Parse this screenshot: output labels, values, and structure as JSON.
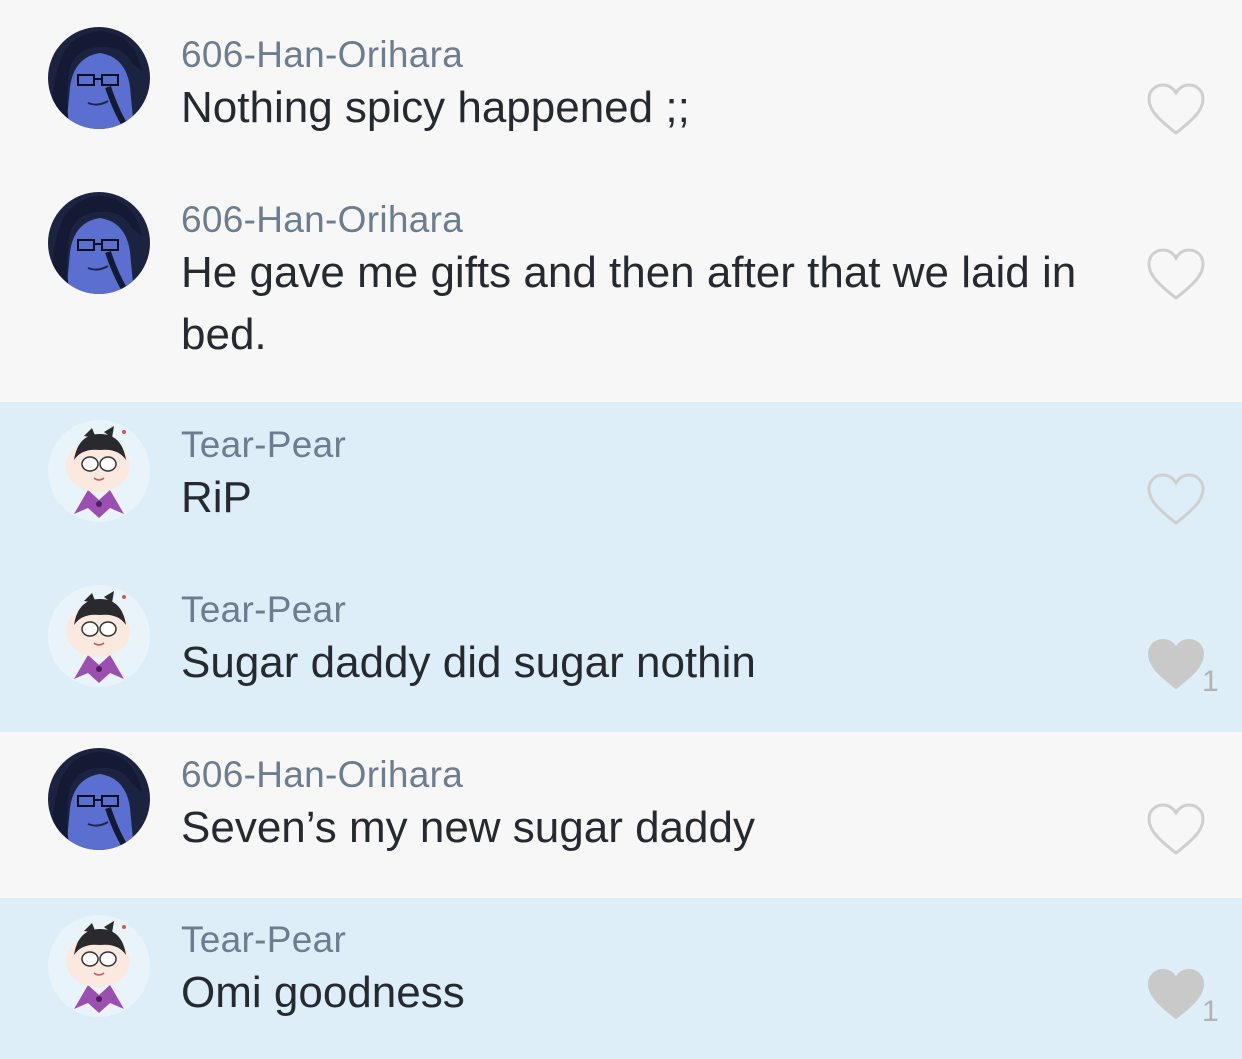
{
  "comments": [
    {
      "username": "606-Han-Orihara",
      "message": "Nothing spicy happened ;;",
      "avatar_icon": "dark-haired-character-avatar-icon",
      "liked": false,
      "likes": null
    },
    {
      "username": "606-Han-Orihara",
      "message": "He gave me gifts and then after that we laid in bed.",
      "avatar_icon": "dark-haired-character-avatar-icon",
      "liked": false,
      "likes": null
    },
    {
      "username": "Tear-Pear",
      "message": "RiP",
      "avatar_icon": "chibi-character-avatar-icon",
      "liked": false,
      "likes": null
    },
    {
      "username": "Tear-Pear",
      "message": "Sugar daddy did sugar nothin",
      "avatar_icon": "chibi-character-avatar-icon",
      "liked": true,
      "likes": "1"
    },
    {
      "username": "606-Han-Orihara",
      "message": "Seven’s my new sugar daddy",
      "avatar_icon": "dark-haired-character-avatar-icon",
      "liked": false,
      "likes": null
    },
    {
      "username": "Tear-Pear",
      "message": "Omi goodness",
      "avatar_icon": "chibi-character-avatar-icon",
      "liked": true,
      "likes": "1"
    }
  ],
  "colors": {
    "row_plain": "#f7f7f7",
    "row_highlight": "#ddeef8",
    "username": "#6d7c8f",
    "message": "#262a30",
    "heart_outline": "#cfcfcf",
    "heart_filled": "#c9c9c9"
  }
}
